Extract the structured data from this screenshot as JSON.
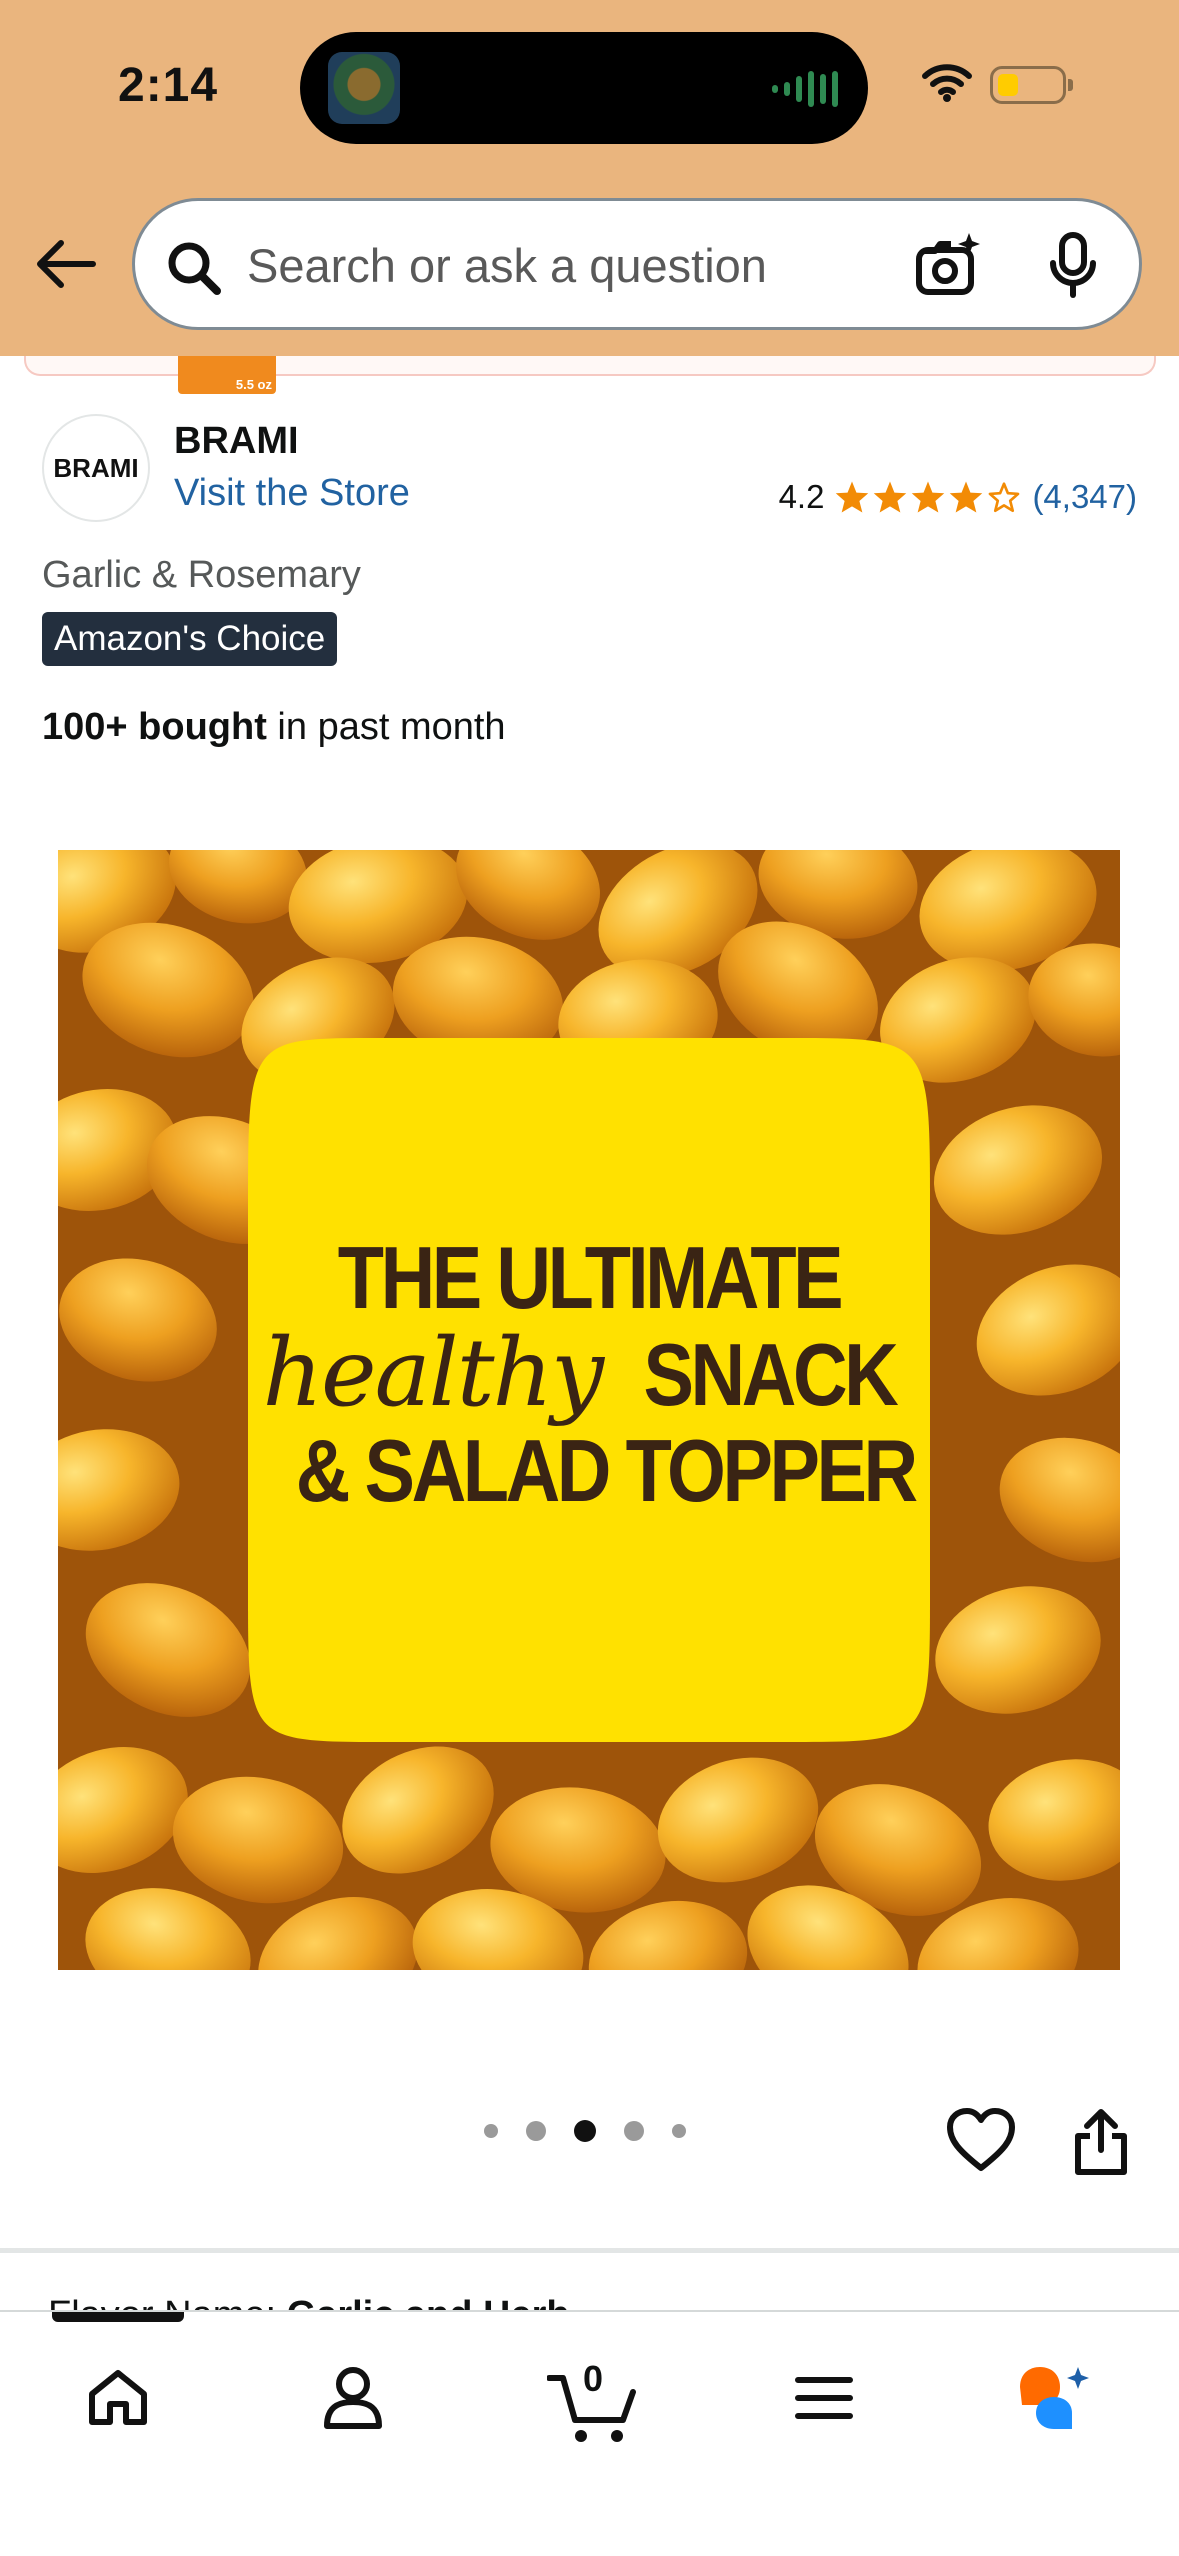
{
  "status_bar": {
    "time": "2:14"
  },
  "search": {
    "placeholder": "Search or ask a question"
  },
  "previous_item": {
    "size_label": "5.5 oz"
  },
  "product": {
    "brand_logo_text": "BRAMI",
    "brand_name": "BRAMI",
    "visit_store": "Visit the Store",
    "rating": "4.2",
    "stars": 4.2,
    "rating_count": "(4,347)",
    "variant": "Garlic & Rosemary",
    "badge": "Amazon's Choice",
    "bought_bold": "100+ bought",
    "bought_rest": " in past month"
  },
  "image": {
    "line1": "THE ULTIMATE",
    "line2_script": "healthy",
    "line2_rest": "SNACK",
    "line3": "& SALAD TOPPER"
  },
  "carousel": {
    "total": 5,
    "active_index": 2
  },
  "peek": {
    "label": "Flavor Name: ",
    "value": "Garlic and Herb"
  },
  "tabbar": {
    "cart_count": "0",
    "tabs": [
      "home-icon",
      "account-icon",
      "cart-icon",
      "menu-icon",
      "rufus-icon"
    ]
  },
  "colors": {
    "header_bg": "#eab57e",
    "link": "#2162a1",
    "star": "#f28b05",
    "badge_bg": "#232f3e",
    "rufus_orange": "#ff6a00",
    "rufus_blue": "#1e90ff"
  }
}
